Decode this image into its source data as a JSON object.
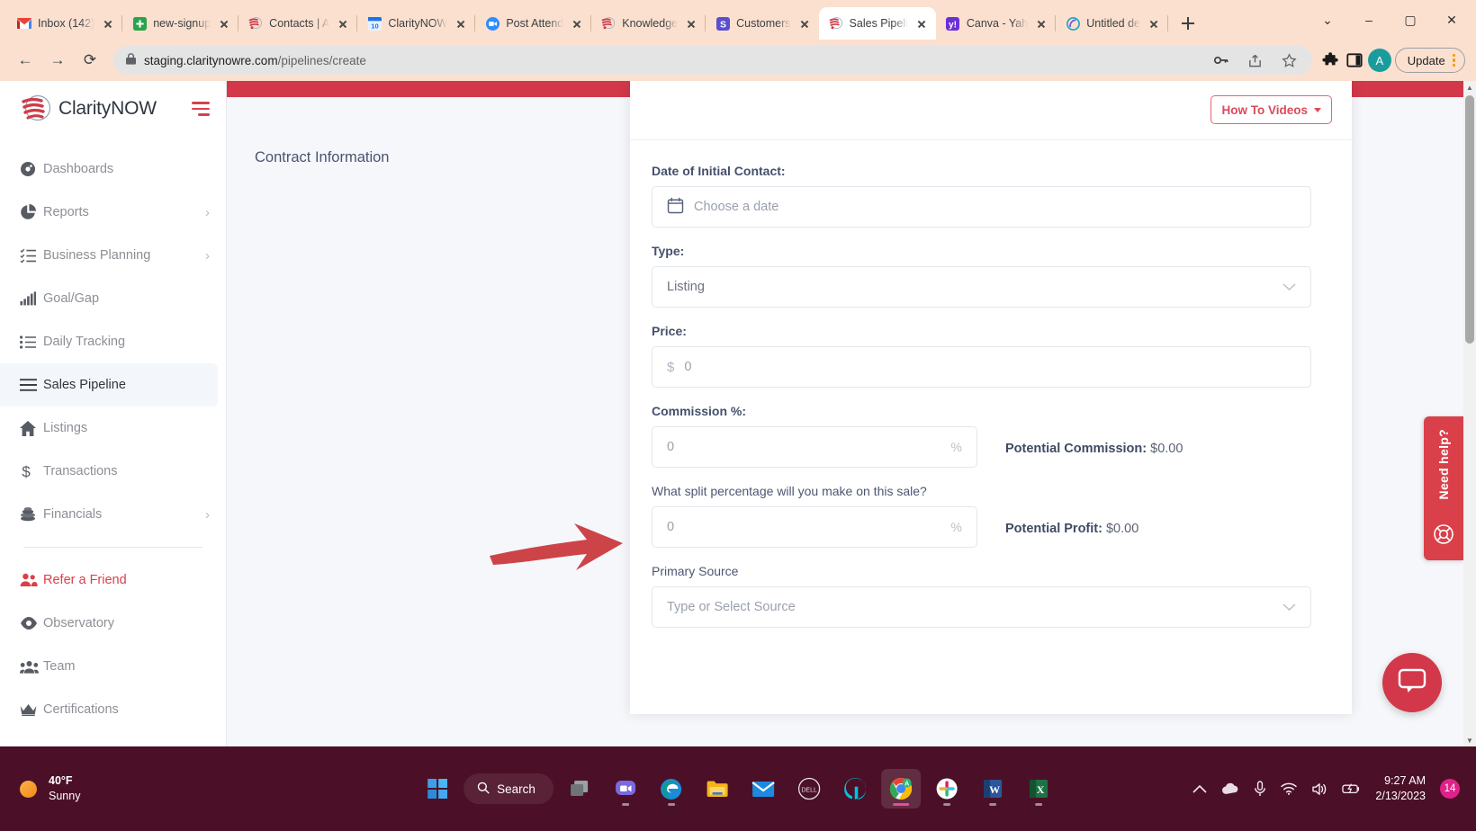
{
  "browser": {
    "tabs": [
      {
        "title": "Inbox (142)",
        "icon": "gmail-icon",
        "active": false
      },
      {
        "title": "new-signup",
        "icon": "sheets-icon",
        "active": false
      },
      {
        "title": "Contacts | A",
        "icon": "claritynow-icon",
        "active": false
      },
      {
        "title": "ClarityNOW",
        "icon": "calendar-10-icon",
        "active": false
      },
      {
        "title": "Post Attend",
        "icon": "zoom-icon",
        "active": false
      },
      {
        "title": "Knowledge",
        "icon": "claritynow-icon",
        "active": false
      },
      {
        "title": "Customers",
        "icon": "slack-s-icon",
        "active": false
      },
      {
        "title": "Sales Pipeli",
        "icon": "claritynow-icon",
        "active": true
      },
      {
        "title": "Canva - Yah",
        "icon": "yahoo-icon",
        "active": false
      },
      {
        "title": "Untitled de",
        "icon": "copilot-icon",
        "active": false
      }
    ],
    "new_tab_label": "+",
    "window_controls": {
      "list": "⌄",
      "minimize": "–",
      "maximize": "▢",
      "close": "✕"
    },
    "nav": {
      "back": "←",
      "forward": "→",
      "reload": "⟳"
    },
    "url_host": "staging.claritynowre.com",
    "url_path": "/pipelines/create",
    "toolbar": {
      "key_icon": "⚷",
      "share_icon": "↗",
      "star_icon": "☆",
      "extensions_icon": "🧩",
      "sidepanel_icon": "▣",
      "profile_initial": "A",
      "update_label": "Update"
    }
  },
  "sidebar": {
    "brand": "ClarityNOW",
    "items": [
      {
        "label": "Dashboards",
        "icon": "dashboard-icon",
        "caret": "",
        "active": false,
        "accent": false
      },
      {
        "label": "Reports",
        "icon": "pie-chart-icon",
        "caret": "›",
        "active": false,
        "accent": false
      },
      {
        "label": "Business Planning",
        "icon": "checklist-icon",
        "caret": "›",
        "active": false,
        "accent": false
      },
      {
        "label": "Goal/Gap",
        "icon": "bar-chart-icon",
        "caret": "",
        "active": false,
        "accent": false
      },
      {
        "label": "Daily Tracking",
        "icon": "list-icon",
        "caret": "",
        "active": false,
        "accent": false
      },
      {
        "label": "Sales Pipeline",
        "icon": "menu-lines-icon",
        "caret": "",
        "active": true,
        "accent": false
      },
      {
        "label": "Listings",
        "icon": "home-icon",
        "caret": "",
        "active": false,
        "accent": false
      },
      {
        "label": "Transactions",
        "icon": "dollar-icon",
        "caret": "",
        "active": false,
        "accent": false
      },
      {
        "label": "Financials",
        "icon": "coins-icon",
        "caret": "›",
        "active": false,
        "accent": false
      }
    ],
    "items_secondary": [
      {
        "label": "Refer a Friend",
        "icon": "people-icon",
        "caret": "",
        "active": false,
        "accent": true
      },
      {
        "label": "Observatory",
        "icon": "eye-icon",
        "caret": "",
        "active": false,
        "accent": false
      },
      {
        "label": "Team",
        "icon": "team-icon",
        "caret": "",
        "active": false,
        "accent": false
      },
      {
        "label": "Certifications",
        "icon": "crown-icon",
        "caret": "",
        "active": false,
        "accent": false
      }
    ]
  },
  "page": {
    "section_title": "Contract Information",
    "how_to_videos": "How To Videos",
    "fields": {
      "date_label": "Date of Initial Contact:",
      "date_placeholder": "Choose a date",
      "type_label": "Type:",
      "type_value": "Listing",
      "price_label": "Price:",
      "price_prefix": "$",
      "price_placeholder": "0",
      "commission_label": "Commission %:",
      "commission_placeholder": "0",
      "commission_suffix": "%",
      "potential_commission_label": "Potential Commission:",
      "potential_commission_value": "$0.00",
      "split_label": "What split percentage will you make on this sale?",
      "split_placeholder": "0",
      "split_suffix": "%",
      "potential_profit_label": "Potential Profit:",
      "potential_profit_value": "$0.00",
      "source_label": "Primary Source",
      "source_placeholder": "Type or Select Source"
    },
    "need_help": "Need help?",
    "accent_color": "#d9404a",
    "band_color": "#d2384a"
  },
  "taskbar": {
    "weather_temp": "40°F",
    "weather_cond": "Sunny",
    "search_label": "Search",
    "apps": [
      {
        "name": "start-button"
      },
      {
        "name": "search-button"
      },
      {
        "name": "task-view-button"
      },
      {
        "name": "teams-chat-button"
      },
      {
        "name": "edge-button"
      },
      {
        "name": "file-explorer-button"
      },
      {
        "name": "mail-button"
      },
      {
        "name": "dell-button"
      },
      {
        "name": "alexa-button"
      },
      {
        "name": "chrome-button"
      },
      {
        "name": "slack-button"
      },
      {
        "name": "word-button"
      },
      {
        "name": "excel-button"
      }
    ],
    "tray": {
      "chevron": "⌃",
      "cloud_icon": "onedrive-icon",
      "mic_icon": "microphone-icon",
      "wifi_icon": "wifi-icon",
      "volume_icon": "speaker-icon",
      "battery_icon": "battery-icon"
    },
    "time": "9:27 AM",
    "date": "2/13/2023",
    "notification_count": "14"
  }
}
